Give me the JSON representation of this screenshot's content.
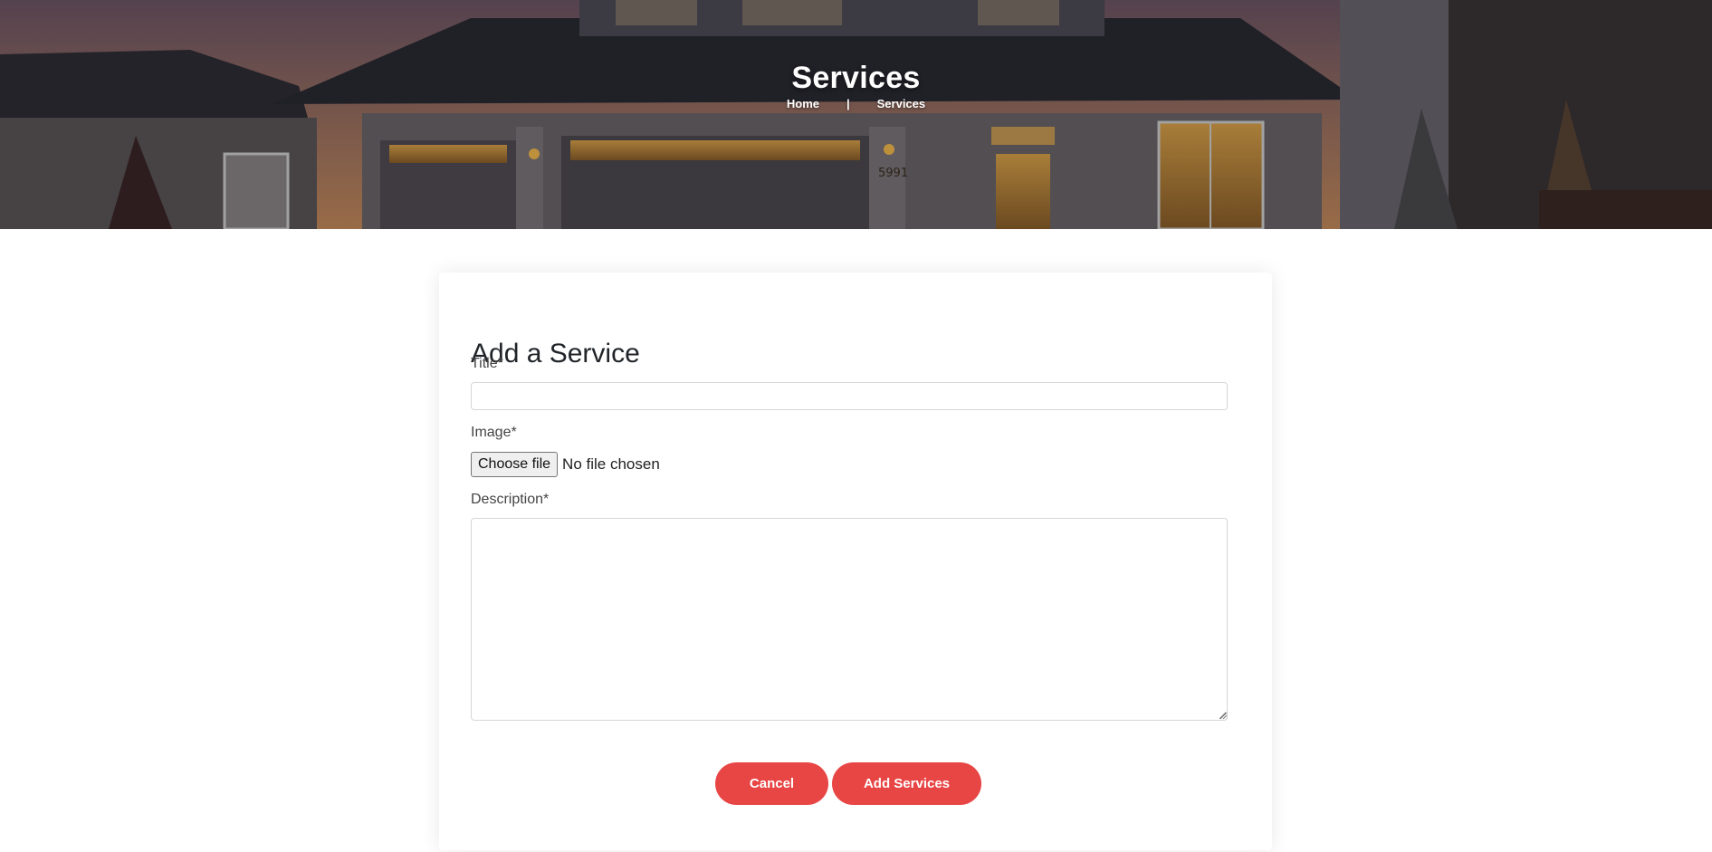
{
  "hero": {
    "title": "Services",
    "breadcrumb": {
      "home": "Home",
      "separator": "|",
      "current": "Services"
    },
    "house_number": "5991"
  },
  "form": {
    "heading": "Add a Service",
    "title_label": "Title*",
    "title_value": "",
    "image_label": "Image*",
    "file_button": "Choose file",
    "file_status": "No file chosen",
    "description_label": "Description*",
    "description_value": "",
    "cancel_label": "Cancel",
    "submit_label": "Add Services"
  },
  "colors": {
    "accent": "#e84545",
    "text": "#212529",
    "label": "#444444",
    "border": "#d6d6d6"
  }
}
